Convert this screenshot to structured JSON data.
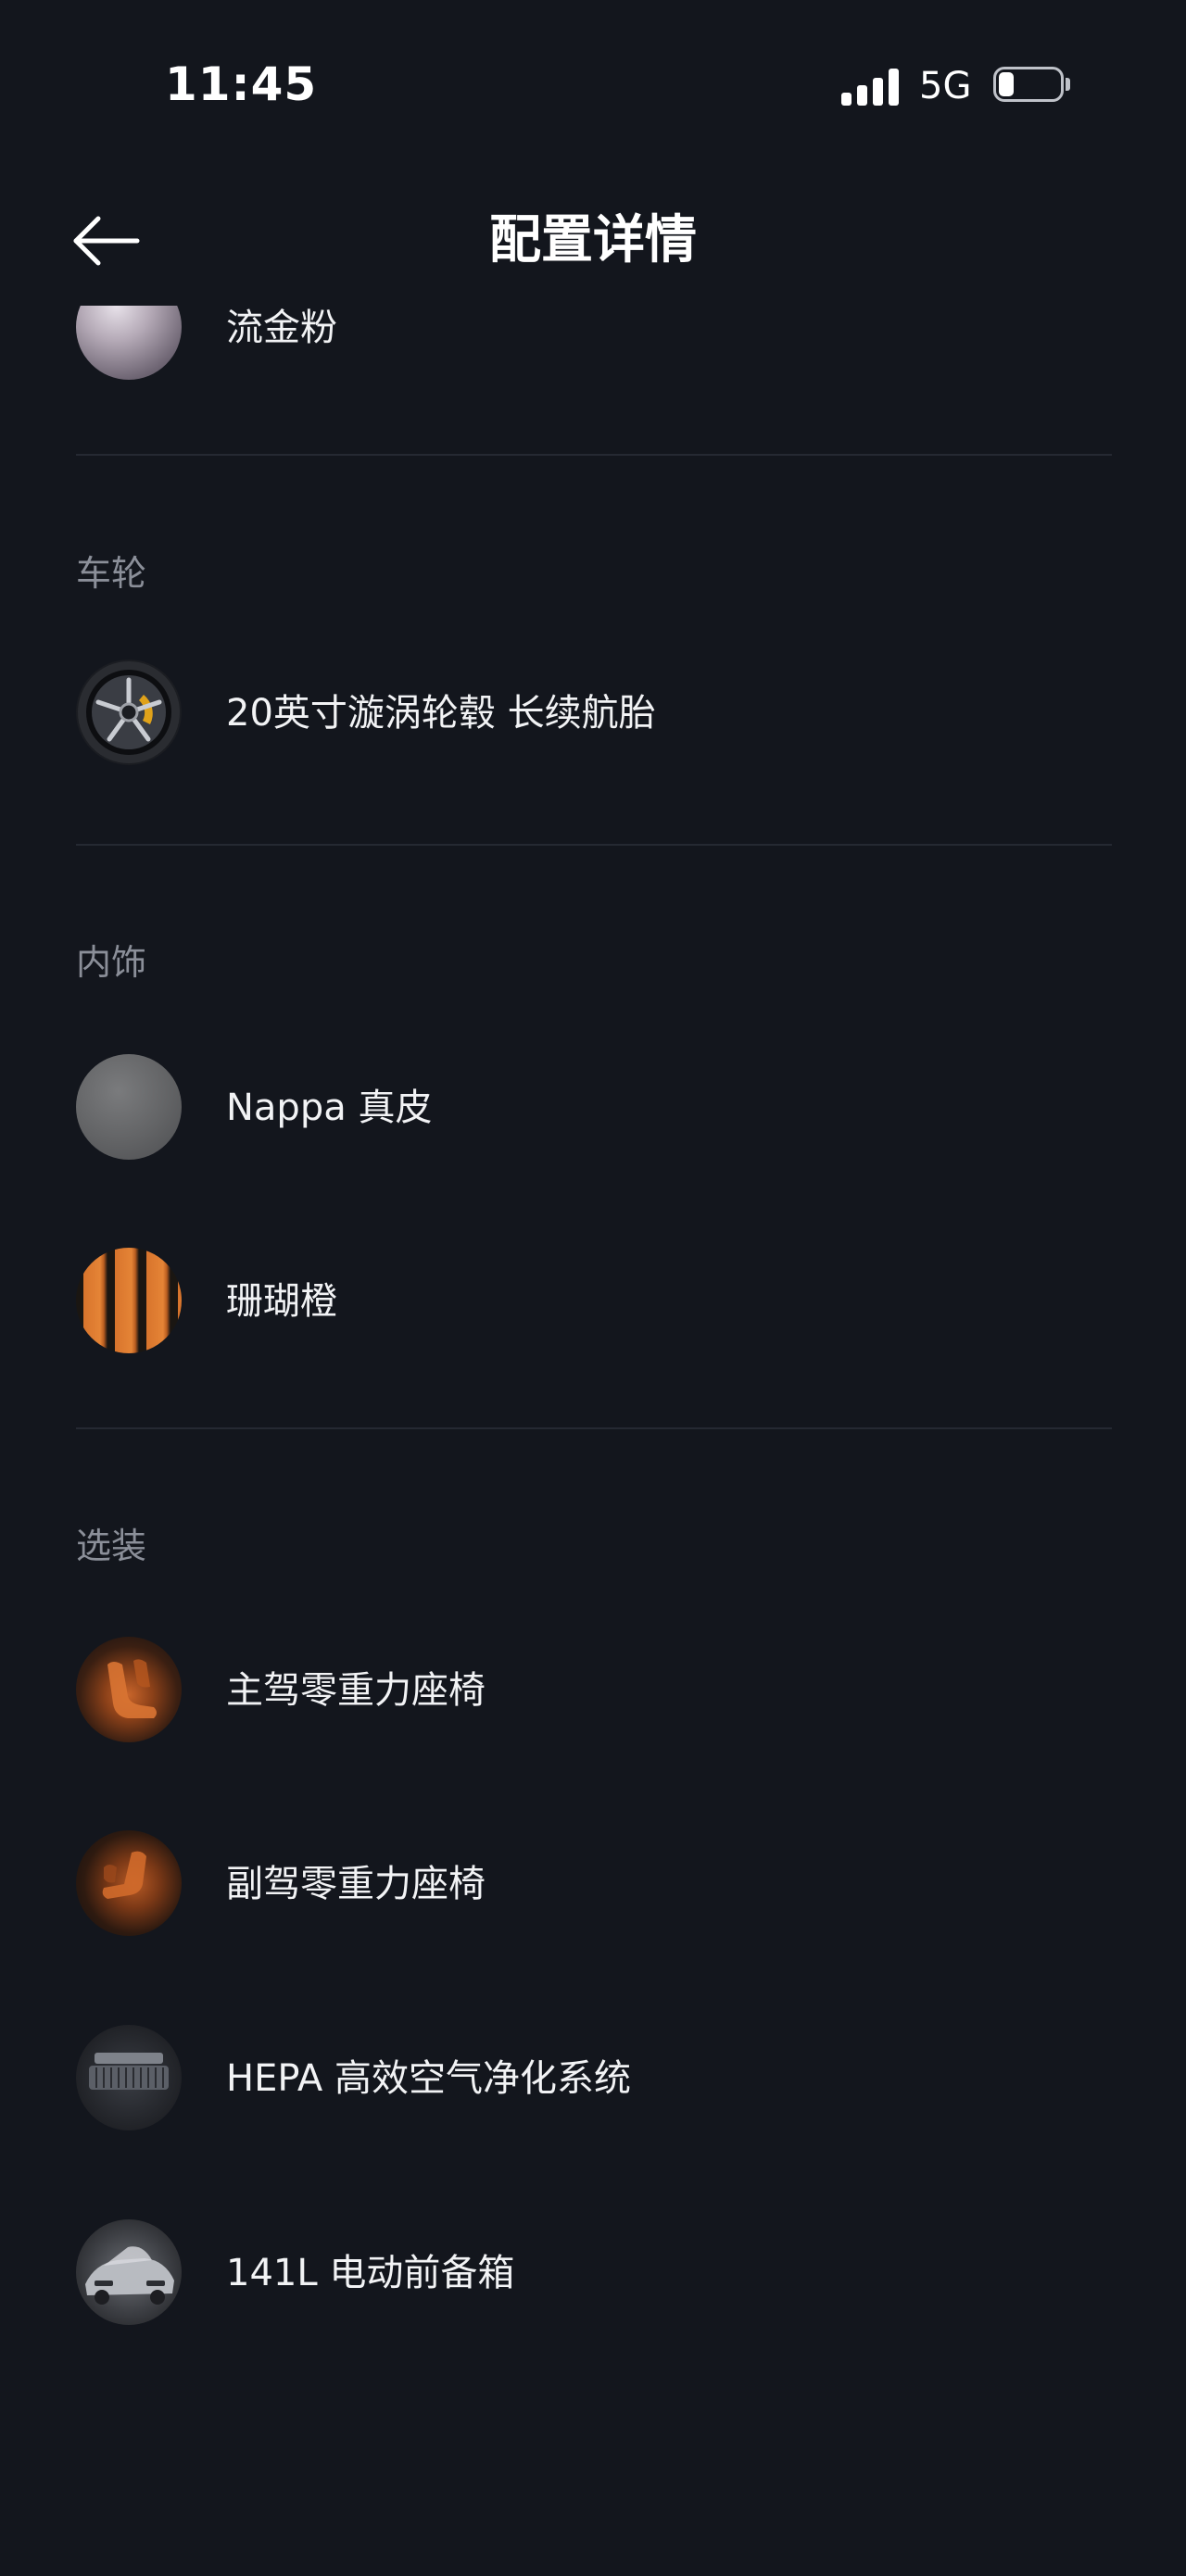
{
  "status_bar": {
    "time": "11:45",
    "network": "5G",
    "battery_level": 0.25,
    "signal_bars": 4
  },
  "header": {
    "title": "配置详情",
    "back_icon": "arrow-left-icon"
  },
  "colors": {
    "background": "#13161d",
    "divider": "#252932",
    "section_title": "#8b8f99",
    "text": "#f2f3f5"
  },
  "sections": {
    "exterior": {
      "items": [
        {
          "label": "流金粉",
          "thumb": "paint-swatch-rose-gold"
        }
      ]
    },
    "wheels": {
      "title": "车轮",
      "items": [
        {
          "label": "20英寸漩涡轮毂 长续航胎",
          "thumb": "wheel-icon"
        }
      ]
    },
    "interior": {
      "title": "内饰",
      "items": [
        {
          "label": "Nappa 真皮",
          "thumb": "leather-swatch-grey"
        },
        {
          "label": "珊瑚橙",
          "thumb": "leather-swatch-orange"
        }
      ]
    },
    "options": {
      "title": "选装",
      "items": [
        {
          "label": "主驾零重力座椅",
          "thumb": "seat-icon"
        },
        {
          "label": "副驾零重力座椅",
          "thumb": "seat-icon"
        },
        {
          "label": "HEPA 高效空气净化系统",
          "thumb": "air-filter-icon"
        },
        {
          "label": "141L 电动前备箱",
          "thumb": "front-trunk-icon"
        }
      ]
    }
  }
}
